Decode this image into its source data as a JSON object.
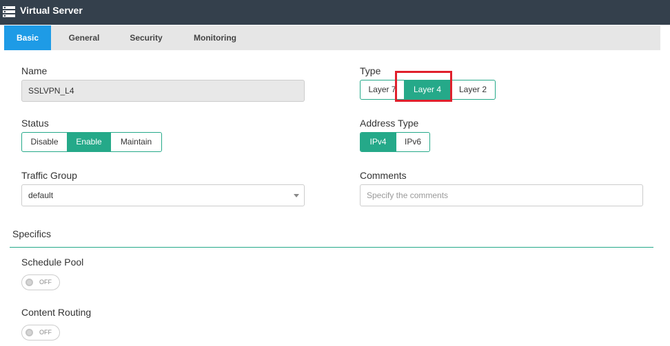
{
  "window": {
    "title": "Virtual Server",
    "icon": "server-icon"
  },
  "tabs": [
    {
      "label": "Basic",
      "active": true
    },
    {
      "label": "General",
      "active": false
    },
    {
      "label": "Security",
      "active": false
    },
    {
      "label": "Monitoring",
      "active": false
    }
  ],
  "name": {
    "label": "Name",
    "value": "SSLVPN_L4"
  },
  "type": {
    "label": "Type",
    "options": [
      "Layer 7",
      "Layer 4",
      "Layer 2"
    ],
    "selected": "Layer 4"
  },
  "status": {
    "label": "Status",
    "options": [
      "Disable",
      "Enable",
      "Maintain"
    ],
    "selected": "Enable"
  },
  "address_type": {
    "label": "Address Type",
    "options": [
      "IPv4",
      "IPv6"
    ],
    "selected": "IPv4"
  },
  "traffic_group": {
    "label": "Traffic Group",
    "value": "default"
  },
  "comments": {
    "label": "Comments",
    "placeholder": "Specify the comments"
  },
  "specifics": {
    "title": "Specifics",
    "schedule_pool": {
      "label": "Schedule Pool",
      "state": "OFF"
    },
    "content_routing": {
      "label": "Content Routing",
      "state": "OFF"
    }
  },
  "colors": {
    "accent": "#25a989",
    "tab_active": "#1e9be6",
    "header": "#34404c",
    "highlight": "#e0202c"
  }
}
